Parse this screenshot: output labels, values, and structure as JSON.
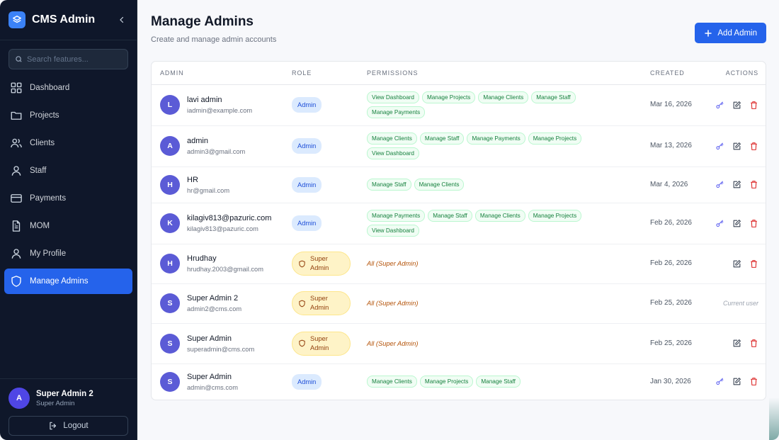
{
  "sidebar": {
    "brand": "CMS Admin",
    "search_placeholder": "Search features...",
    "items": [
      {
        "label": "Dashboard",
        "icon": "grid-icon",
        "active": false
      },
      {
        "label": "Projects",
        "icon": "folder-icon",
        "active": false
      },
      {
        "label": "Clients",
        "icon": "users-icon",
        "active": false
      },
      {
        "label": "Staff",
        "icon": "user-icon",
        "active": false
      },
      {
        "label": "Payments",
        "icon": "credit-card-icon",
        "active": false
      },
      {
        "label": "MOM",
        "icon": "document-icon",
        "active": false
      },
      {
        "label": "My Profile",
        "icon": "profile-icon",
        "active": false
      },
      {
        "label": "Manage Admins",
        "icon": "shield-icon",
        "active": true
      }
    ],
    "user": {
      "initial": "A",
      "name": "Super Admin 2",
      "role": "Super Admin"
    },
    "logout_label": "Logout"
  },
  "header": {
    "title": "Manage Admins",
    "subtitle": "Create and manage admin accounts",
    "add_button": "Add Admin"
  },
  "table": {
    "columns": [
      "ADMIN",
      "ROLE",
      "PERMISSIONS",
      "CREATED",
      "ACTIONS"
    ],
    "rows": [
      {
        "initial": "L",
        "name": "lavi admin",
        "email": "iadmin@example.com",
        "role": "Admin",
        "super": false,
        "permissions": [
          "View Dashboard",
          "Manage Projects",
          "Manage Clients",
          "Manage Staff",
          "Manage Payments"
        ],
        "created": "Mar 16, 2026",
        "actions": [
          "key",
          "edit",
          "delete"
        ]
      },
      {
        "initial": "A",
        "name": "admin",
        "email": "admin3@gmail.com",
        "role": "Admin",
        "super": false,
        "permissions": [
          "Manage Clients",
          "Manage Staff",
          "Manage Payments",
          "Manage Projects",
          "View Dashboard"
        ],
        "created": "Mar 13, 2026",
        "actions": [
          "key",
          "edit",
          "delete"
        ]
      },
      {
        "initial": "H",
        "name": "HR",
        "email": "hr@gmail.com",
        "role": "Admin",
        "super": false,
        "permissions": [
          "Manage Staff",
          "Manage Clients"
        ],
        "created": "Mar 4, 2026",
        "actions": [
          "key",
          "edit",
          "delete"
        ]
      },
      {
        "initial": "K",
        "name": "kilagiv813@pazuric.com",
        "email": "kilagiv813@pazuric.com",
        "role": "Admin",
        "super": false,
        "permissions": [
          "Manage Payments",
          "Manage Staff",
          "Manage Clients",
          "Manage Projects",
          "View Dashboard"
        ],
        "created": "Feb 26, 2026",
        "actions": [
          "key",
          "edit",
          "delete"
        ]
      },
      {
        "initial": "H",
        "name": "Hrudhay",
        "email": "hrudhay.2003@gmail.com",
        "role": "Super Admin",
        "super": true,
        "permissions_text": "All (Super Admin)",
        "created": "Feb 26, 2026",
        "actions": [
          "edit",
          "delete"
        ]
      },
      {
        "initial": "S",
        "name": "Super Admin 2",
        "email": "admin2@cms.com",
        "role": "Super Admin",
        "super": true,
        "permissions_text": "All (Super Admin)",
        "created": "Feb 25, 2026",
        "actions": [],
        "current_user_text": "Current user"
      },
      {
        "initial": "S",
        "name": "Super Admin",
        "email": "superadmin@cms.com",
        "role": "Super Admin",
        "super": true,
        "permissions_text": "All (Super Admin)",
        "created": "Feb 25, 2026",
        "actions": [
          "edit",
          "delete"
        ]
      },
      {
        "initial": "S",
        "name": "Super Admin",
        "email": "admin@cms.com",
        "role": "Admin",
        "super": false,
        "permissions": [
          "Manage Clients",
          "Manage Projects",
          "Manage Staff"
        ],
        "created": "Jan 30, 2026",
        "actions": [
          "key",
          "edit",
          "delete"
        ]
      }
    ]
  },
  "colors": {
    "sidebar_bg": "#0f172a",
    "accent": "#2563eb",
    "avatar": "#5b5bd6",
    "delete": "#dc2626",
    "key": "#6366f1"
  }
}
